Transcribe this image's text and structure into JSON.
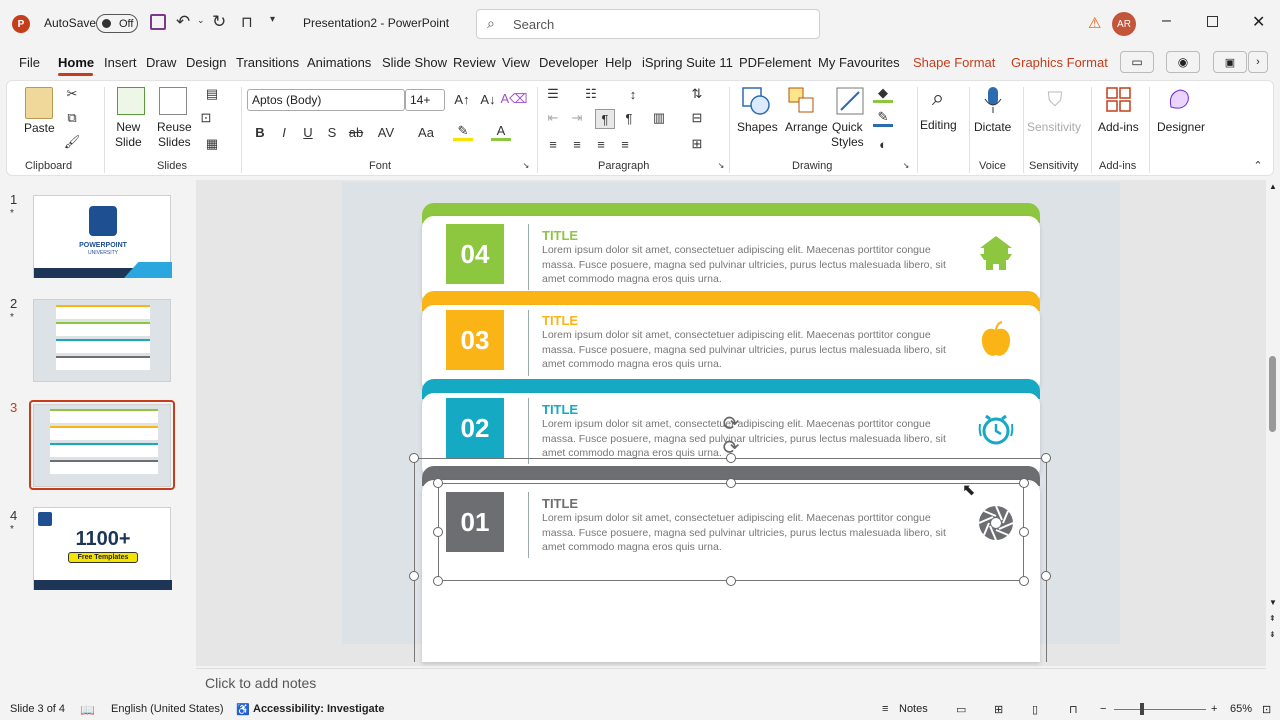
{
  "titlebar": {
    "autosave_label": "AutoSave",
    "autosave_state": "Off",
    "document_title": "Presentation2  -  PowerPoint",
    "search_placeholder": "Search",
    "user_initials": "AR"
  },
  "menu": {
    "tabs": [
      "File",
      "Home",
      "Insert",
      "Draw",
      "Design",
      "Transitions",
      "Animations",
      "Slide Show",
      "Review",
      "View",
      "Developer",
      "Help",
      "iSpring Suite 11",
      "PDFelement",
      "My Favourites",
      "Shape Format",
      "Graphics Format"
    ],
    "active": "Home"
  },
  "ribbon": {
    "clipboard": {
      "paste": "Paste",
      "label": "Clipboard"
    },
    "slides": {
      "new_slide": "New",
      "new_slide2": "Slide",
      "reuse": "Reuse",
      "reuse2": "Slides",
      "label": "Slides"
    },
    "font": {
      "name": "Aptos (Body)",
      "size": "14+",
      "label": "Font"
    },
    "paragraph": {
      "label": "Paragraph"
    },
    "drawing": {
      "shapes": "Shapes",
      "arrange": "Arrange",
      "quick": "Quick",
      "quick2": "Styles",
      "label": "Drawing"
    },
    "editing": {
      "label": "Editing"
    },
    "voice": {
      "dictate": "Dictate",
      "label": "Voice"
    },
    "sensitivity": {
      "btn": "Sensitivity",
      "label": "Sensitivity"
    },
    "addins": {
      "btn": "Add-ins",
      "label": "Add-ins"
    },
    "designer": {
      "btn": "Designer"
    }
  },
  "thumbnails": [
    {
      "num": "1",
      "star": "*",
      "headline": "POWERPOINT",
      "sub": "UNIVERSITY"
    },
    {
      "num": "2",
      "star": "*"
    },
    {
      "num": "3",
      "star": "*"
    },
    {
      "num": "4",
      "star": "*",
      "headline": "1100+",
      "sub": "Free Templates"
    }
  ],
  "slide": {
    "cards": [
      {
        "num": "04",
        "title": "TITLE",
        "text": "Lorem ipsum dolor sit amet, consectetuer adipiscing elit. Maecenas porttitor congue massa. Fusce posuere, magna sed pulvinar ultricies, purus lectus malesuada libero, sit amet commodo magna eros quis urna.",
        "color": "#8dc63f",
        "icon": "pagoda-icon"
      },
      {
        "num": "03",
        "title": "TITLE",
        "text": "Lorem ipsum dolor sit amet, consectetuer adipiscing elit. Maecenas porttitor congue massa. Fusce posuere, magna sed pulvinar ultricies, purus lectus malesuada libero, sit amet commodo magna eros quis urna.",
        "color": "#fbb415",
        "icon": "apple-icon"
      },
      {
        "num": "02",
        "title": "TITLE",
        "text": "Lorem ipsum dolor sit amet, consectetuer adipiscing elit. Maecenas porttitor congue massa. Fusce posuere, magna sed pulvinar ultricies, purus lectus malesuada libero, sit amet commodo magna eros quis urna.",
        "color": "#16a9c3",
        "icon": "alarm-clock-icon"
      },
      {
        "num": "01",
        "title": "TITLE",
        "text": "Lorem ipsum dolor sit amet, consectetuer adipiscing elit. Maecenas porttitor congue massa. Fusce posuere, magna sed pulvinar ultricies, purus lectus malesuada libero, sit amet commodo magna eros quis urna.",
        "color": "#6d6e71",
        "icon": "aperture-icon"
      }
    ]
  },
  "notes": {
    "placeholder": "Click to add notes"
  },
  "status": {
    "slide_of": "Slide 3 of 4",
    "language": "English (United States)",
    "accessibility": "Accessibility: Investigate",
    "notes": "Notes",
    "zoom": "65%"
  }
}
